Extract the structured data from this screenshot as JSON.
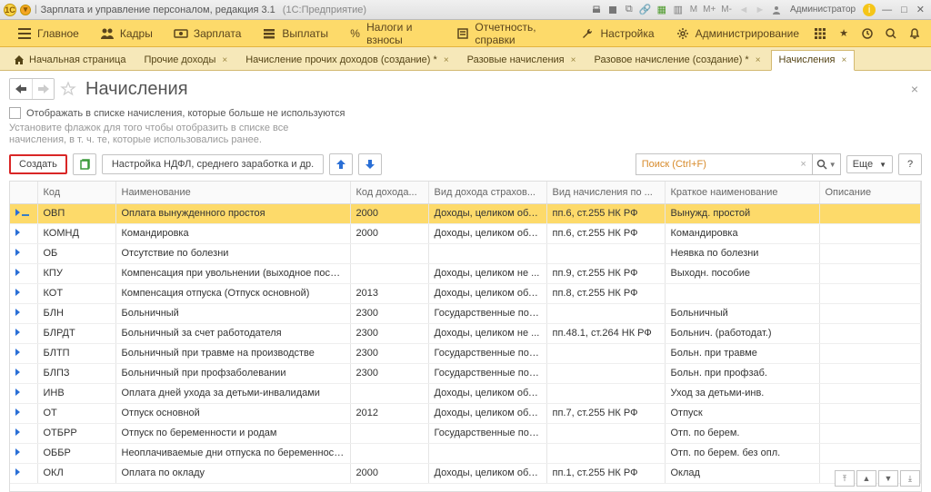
{
  "titlebar": {
    "app_title": "Зарплата и управление персоналом, редакция 3.1",
    "platform": "(1С:Предприятие)",
    "user_label": "Администратор",
    "m_buttons": [
      "M",
      "M+",
      "M-"
    ]
  },
  "mainmenu": {
    "items": [
      {
        "label": "Главное"
      },
      {
        "label": "Кадры"
      },
      {
        "label": "Зарплата"
      },
      {
        "label": "Выплаты"
      },
      {
        "label": "Налоги и взносы"
      },
      {
        "label": "Отчетность, справки"
      },
      {
        "label": "Настройка"
      },
      {
        "label": "Администрирование"
      }
    ]
  },
  "tabs": [
    {
      "label": "Начальная страница",
      "home": true,
      "closable": false
    },
    {
      "label": "Прочие доходы",
      "closable": true
    },
    {
      "label": "Начисление прочих доходов (создание) *",
      "closable": true
    },
    {
      "label": "Разовые начисления",
      "closable": true
    },
    {
      "label": "Разовое начисление (создание) *",
      "closable": true
    },
    {
      "label": "Начисления",
      "closable": true,
      "active": true
    }
  ],
  "page": {
    "title": "Начисления",
    "filter_label": "Отображать в списке начисления, которые больше не используются",
    "hint": "Установите флажок для того чтобы отобразить в списке все начисления, в т. ч. те, которые использовались ранее.",
    "create_label": "Создать",
    "ndfl_label": "Настройка НДФЛ, среднего заработка и др.",
    "search_placeholder": "Поиск (Ctrl+F)",
    "more_label": "Еще",
    "help_label": "?"
  },
  "columns": [
    "Код",
    "Наименование",
    "Код дохода...",
    "Вид дохода страхов...",
    "Вид начисления по ...",
    "Краткое наименование",
    "Описание"
  ],
  "rows": [
    {
      "code": "ОВП",
      "name": "Оплата вынужденного простоя",
      "kd": "2000",
      "vds": "Доходы, целиком обл...",
      "vnp": "пп.6, ст.255 НК РФ",
      "short": "Вынужд. простой",
      "desc": "",
      "sel": true
    },
    {
      "code": "КОМНД",
      "name": "Командировка",
      "kd": "2000",
      "vds": "Доходы, целиком обл...",
      "vnp": "пп.6, ст.255 НК РФ",
      "short": "Командировка",
      "desc": ""
    },
    {
      "code": "ОБ",
      "name": "Отсутствие по болезни",
      "kd": "",
      "vds": "",
      "vnp": "",
      "short": "Неявка по болезни",
      "desc": ""
    },
    {
      "code": "КПУ",
      "name": "Компенсация при увольнении (выходное пособие)",
      "kd": "",
      "vds": "Доходы, целиком не ...",
      "vnp": "пп.9, ст.255 НК РФ",
      "short": "Выходн. пособие",
      "desc": ""
    },
    {
      "code": "КОТ",
      "name": "Компенсация отпуска (Отпуск основной)",
      "kd": "2013",
      "vds": "Доходы, целиком обл...",
      "vnp": "пп.8, ст.255 НК РФ",
      "short": "",
      "desc": ""
    },
    {
      "code": "БЛН",
      "name": "Больничный",
      "kd": "2300",
      "vds": "Государственные пос...",
      "vnp": "",
      "short": "Больничный",
      "desc": ""
    },
    {
      "code": "БЛРДТ",
      "name": "Больничный за счет работодателя",
      "kd": "2300",
      "vds": "Доходы, целиком не ...",
      "vnp": "пп.48.1, ст.264 НК РФ",
      "short": "Больнич. (работодат.)",
      "desc": ""
    },
    {
      "code": "БЛТП",
      "name": "Больничный при травме на производстве",
      "kd": "2300",
      "vds": "Государственные пос...",
      "vnp": "",
      "short": "Больн. при травме",
      "desc": ""
    },
    {
      "code": "БЛПЗ",
      "name": "Больничный при профзаболевании",
      "kd": "2300",
      "vds": "Государственные пос...",
      "vnp": "",
      "short": "Больн. при профзаб.",
      "desc": ""
    },
    {
      "code": "ИНВ",
      "name": "Оплата дней ухода за детьми-инвалидами",
      "kd": "",
      "vds": "Доходы, целиком обл...",
      "vnp": "",
      "short": "Уход за детьми-инв.",
      "desc": ""
    },
    {
      "code": "ОТ",
      "name": "Отпуск основной",
      "kd": "2012",
      "vds": "Доходы, целиком обл...",
      "vnp": "пп.7, ст.255 НК РФ",
      "short": "Отпуск",
      "desc": ""
    },
    {
      "code": "ОТБРР",
      "name": "Отпуск по беременности и родам",
      "kd": "",
      "vds": "Государственные пос...",
      "vnp": "",
      "short": "Отп. по берем.",
      "desc": ""
    },
    {
      "code": "ОББР",
      "name": "Неоплачиваемые дни отпуска по беременности и ...",
      "kd": "",
      "vds": "",
      "vnp": "",
      "short": "Отп. по берем. без опл.",
      "desc": ""
    },
    {
      "code": "ОКЛ",
      "name": "Оплата по окладу",
      "kd": "2000",
      "vds": "Доходы, целиком обл...",
      "vnp": "пп.1, ст.255 НК РФ",
      "short": "Оклад",
      "desc": ""
    }
  ]
}
